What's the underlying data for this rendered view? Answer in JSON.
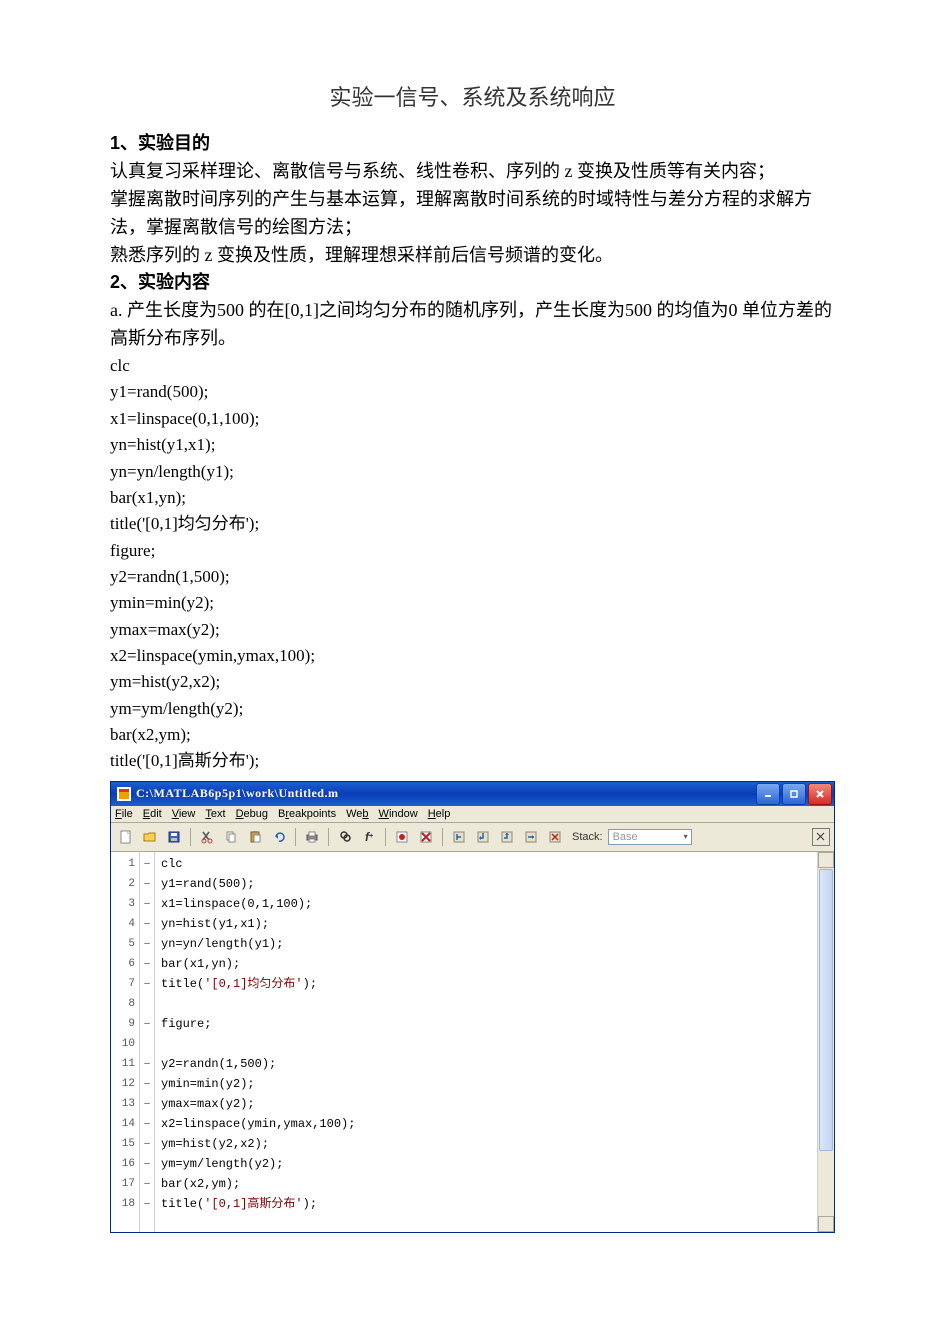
{
  "doc": {
    "title": "实验一信号、系统及系统响应",
    "s1_heading": "1、实验目的",
    "s1_p1": "认真复习采样理论、离散信号与系统、线性卷积、序列的 z 变换及性质等有关内容；",
    "s1_p2": "掌握离散时间序列的产生与基本运算，理解离散时间系统的时域特性与差分方程的求解方法，掌握离散信号的绘图方法；",
    "s1_p3": "熟悉序列的 z 变换及性质，理解理想采样前后信号频谱的变化。",
    "s2_heading": "2、实验内容",
    "s2_a": "a. 产生长度为500 的在[0,1]之间均匀分布的随机序列，产生长度为500 的均值为0 单位方差的高斯分布序列。",
    "code": [
      "clc",
      "y1=rand(500);",
      "x1=linspace(0,1,100);",
      "yn=hist(y1,x1);",
      "yn=yn/length(y1);",
      "bar(x1,yn);",
      "title('[0,1]均匀分布');",
      "",
      "figure;",
      "",
      "y2=randn(1,500);",
      "ymin=min(y2);",
      "ymax=max(y2);",
      "x2=linspace(ymin,ymax,100);",
      "ym=hist(y2,x2);",
      "ym=ym/length(y2);",
      "bar(x2,ym);",
      "title('[0,1]高斯分布');"
    ]
  },
  "matlab": {
    "title": "C:\\MATLAB6p5p1\\work\\Untitled.m",
    "menus": [
      "File",
      "Edit",
      "View",
      "Text",
      "Debug",
      "Breakpoints",
      "Web",
      "Window",
      "Help"
    ],
    "stack_label": "Stack:",
    "stack_value": "Base",
    "lines": [
      {
        "n": "1",
        "dash": "–",
        "pre": "clc",
        "str": ""
      },
      {
        "n": "2",
        "dash": "–",
        "pre": "y1=rand(500);",
        "str": ""
      },
      {
        "n": "3",
        "dash": "–",
        "pre": "x1=linspace(0,1,100);",
        "str": ""
      },
      {
        "n": "4",
        "dash": "–",
        "pre": "yn=hist(y1,x1);",
        "str": ""
      },
      {
        "n": "5",
        "dash": "–",
        "pre": "yn=yn/length(y1);",
        "str": ""
      },
      {
        "n": "6",
        "dash": "–",
        "pre": "bar(x1,yn);",
        "str": ""
      },
      {
        "n": "7",
        "dash": "–",
        "pre": "title(",
        "str": "'[0,1]均匀分布'",
        "post": ");"
      },
      {
        "n": "8",
        "dash": "",
        "pre": "",
        "str": ""
      },
      {
        "n": "9",
        "dash": "–",
        "pre": "figure;",
        "str": ""
      },
      {
        "n": "10",
        "dash": "",
        "pre": "",
        "str": ""
      },
      {
        "n": "11",
        "dash": "–",
        "pre": "y2=randn(1,500);",
        "str": ""
      },
      {
        "n": "12",
        "dash": "–",
        "pre": "ymin=min(y2);",
        "str": ""
      },
      {
        "n": "13",
        "dash": "–",
        "pre": "ymax=max(y2);",
        "str": ""
      },
      {
        "n": "14",
        "dash": "–",
        "pre": "x2=linspace(ymin,ymax,100);",
        "str": ""
      },
      {
        "n": "15",
        "dash": "–",
        "pre": "ym=hist(y2,x2);",
        "str": ""
      },
      {
        "n": "16",
        "dash": "–",
        "pre": "ym=ym/length(y2);",
        "str": ""
      },
      {
        "n": "17",
        "dash": "–",
        "pre": "bar(x2,ym);",
        "str": ""
      },
      {
        "n": "18",
        "dash": "–",
        "pre": "title(",
        "str": "'[0,1]高斯分布'",
        "post": ");"
      }
    ]
  }
}
